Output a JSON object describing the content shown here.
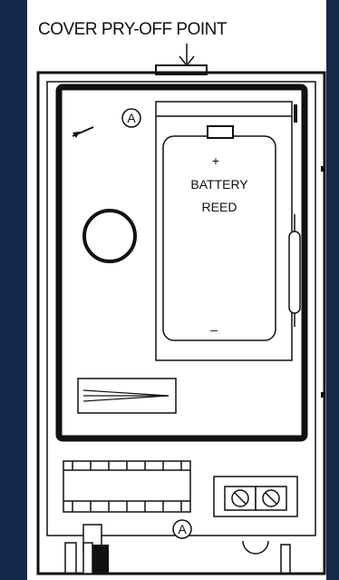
{
  "diagram": {
    "caption": "COVER PRY-OFF POINT",
    "battery_plus": "+",
    "battery_label_1": "BATTERY",
    "battery_label_2": "REED",
    "battery_minus": "–",
    "marker_label": "A",
    "colors": {
      "background": "#15294a",
      "panel": "#ffffff",
      "ink": "#111111"
    }
  }
}
